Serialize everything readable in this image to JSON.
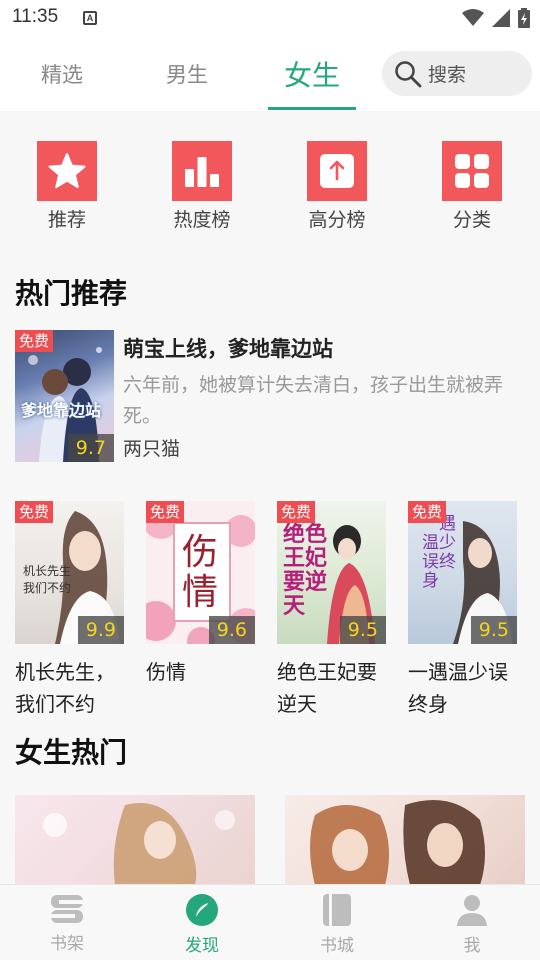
{
  "status_bar": {
    "time": "11:35",
    "notification_glyph": "A"
  },
  "top_tabs": [
    {
      "label": "精选",
      "active": false
    },
    {
      "label": "男生",
      "active": false
    },
    {
      "label": "女生",
      "active": true
    }
  ],
  "search": {
    "placeholder": "搜索"
  },
  "categories": [
    {
      "label": "推荐",
      "icon": "star-icon"
    },
    {
      "label": "热度榜",
      "icon": "bar-chart-icon"
    },
    {
      "label": "高分榜",
      "icon": "arrow-up-icon"
    },
    {
      "label": "分类",
      "icon": "grid-icon"
    }
  ],
  "sections": {
    "hot_recommend": "热门推荐",
    "female_hot": "女生热门"
  },
  "featured": {
    "badge": "免费",
    "score": "9.7",
    "title": "萌宝上线，爹地靠边站",
    "description": "六年前，她被算计失去清白，孩子出生就被弄死。",
    "author": "两只猫",
    "cover_text": "爹地靠边站"
  },
  "books": [
    {
      "badge": "免费",
      "score": "9.9",
      "title": "机长先生，我们不约",
      "cover_text": "机长先生 我们不约"
    },
    {
      "badge": "免费",
      "score": "9.6",
      "title": "伤情",
      "cover_text": "伤情"
    },
    {
      "badge": "免费",
      "score": "9.5",
      "title": "绝色王妃要逆天",
      "cover_text": "绝色王妃要逆天"
    },
    {
      "badge": "免费",
      "score": "9.5",
      "title": "一遇温少误终身",
      "cover_text": "一遇温少误终身"
    }
  ],
  "bottom_nav": [
    {
      "label": "书架",
      "icon": "bookshelf-icon",
      "active": false
    },
    {
      "label": "发现",
      "icon": "compass-icon",
      "active": true
    },
    {
      "label": "书城",
      "icon": "book-icon",
      "active": false
    },
    {
      "label": "我",
      "icon": "user-icon",
      "active": false
    }
  ],
  "colors": {
    "accent": "#25a77e",
    "category_tile": "#f2575b",
    "badge": "#ee4e52",
    "score_text": "#f5d51b"
  }
}
